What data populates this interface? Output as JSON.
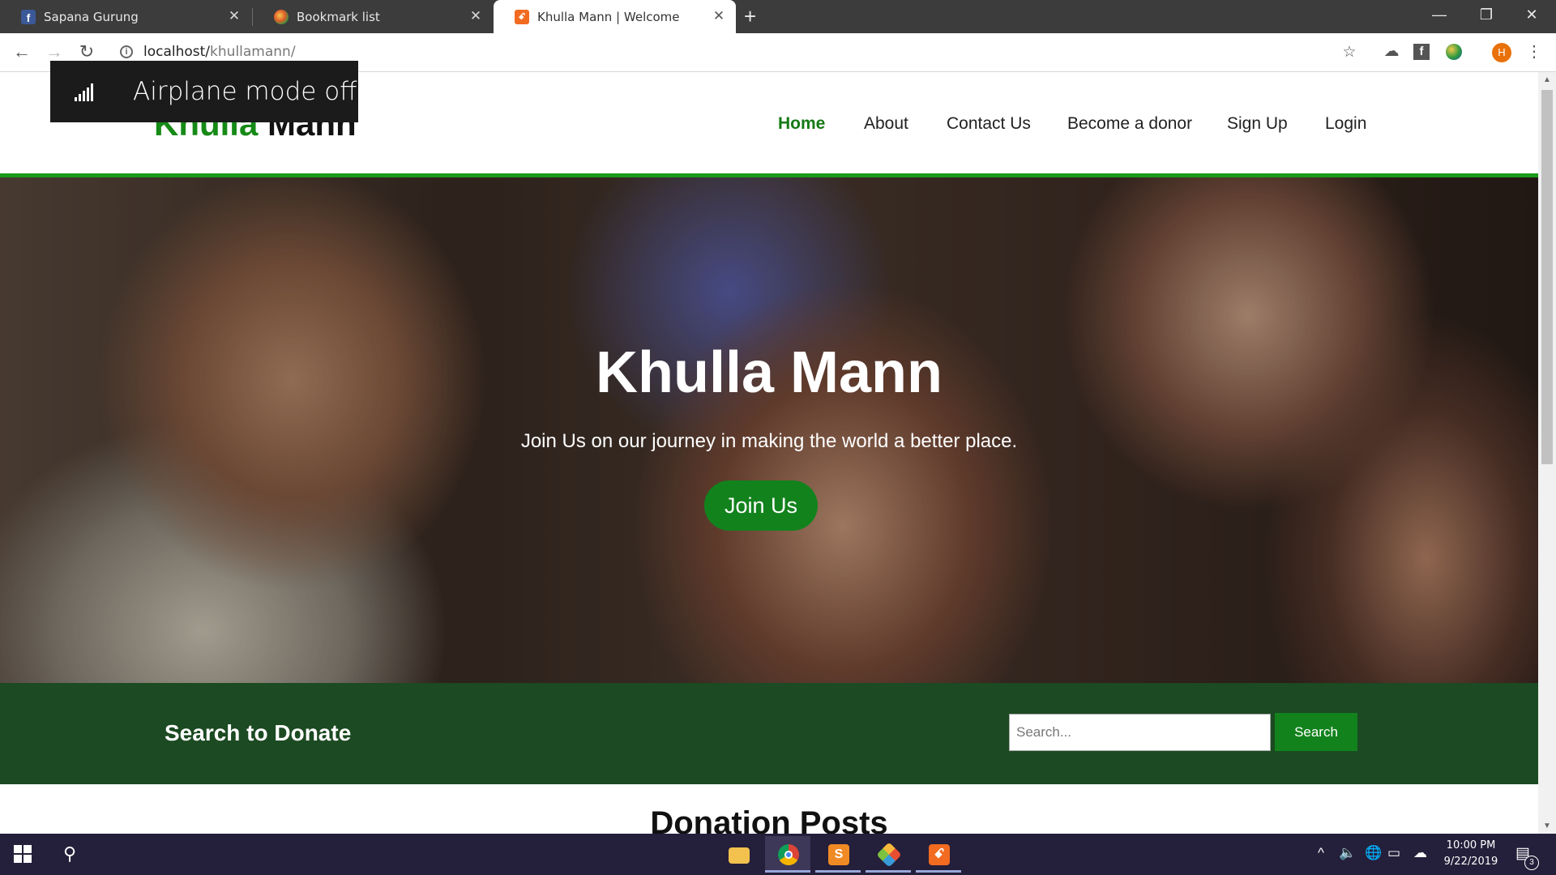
{
  "browser": {
    "tabs": [
      {
        "title": "Sapana Gurung",
        "favicon": "facebook-icon",
        "active": false
      },
      {
        "title": "Bookmark list",
        "favicon": "bookmark-app-icon",
        "active": false
      },
      {
        "title": "Khulla Mann | Welcome",
        "favicon": "xampp-icon",
        "active": true
      }
    ],
    "url_host": "localhost/",
    "url_path": "khullamann/",
    "profile_initial": "H"
  },
  "toast": {
    "message": "Airplane mode off",
    "icon": "signal-bars-icon"
  },
  "site": {
    "logo_part1": "Khulla",
    "logo_part2": "Mann",
    "nav": [
      "Home",
      "About",
      "Contact Us",
      "Become a donor",
      "Sign Up",
      "Login"
    ],
    "active_nav": "Home",
    "accent_color": "#12821d"
  },
  "hero": {
    "title": "Khulla Mann",
    "subtitle": "Join Us on our journey in making the world a better place.",
    "button": "Join Us"
  },
  "search_section": {
    "heading": "Search to Donate",
    "placeholder": "Search...",
    "button": "Search"
  },
  "posts": {
    "heading": "Donation Posts"
  },
  "taskbar": {
    "apps": [
      "file-explorer-icon",
      "chrome-icon",
      "sublime-text-icon",
      "git-icon",
      "xampp-icon"
    ],
    "time": "10:00 PM",
    "date": "9/22/2019",
    "notification_count": "3"
  }
}
